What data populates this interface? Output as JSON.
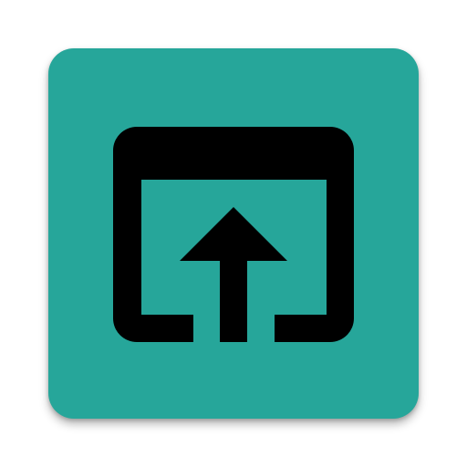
{
  "app_icon": {
    "name": "open-in-browser",
    "background_color": "#26a69a",
    "glyph_color": "#000000",
    "glyph_icon": "open-in-browser-icon"
  }
}
